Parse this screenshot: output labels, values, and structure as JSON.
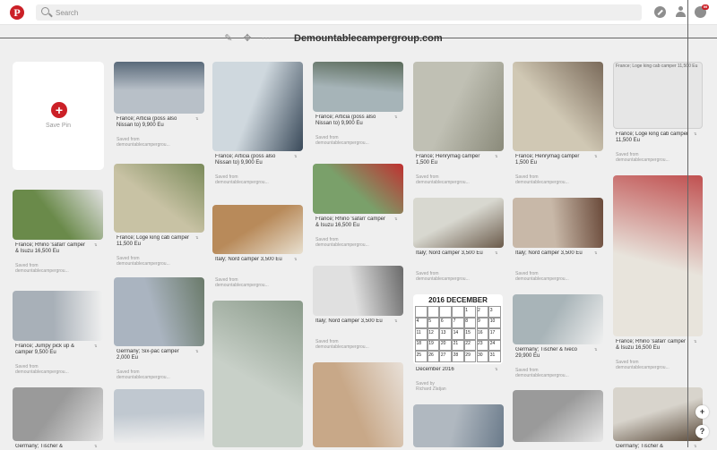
{
  "search": {
    "placeholder": "Search"
  },
  "header": {
    "notification_count": "99"
  },
  "pin_page": {
    "site": "Demountablecampergroup.com",
    "save_pin_label": "Save Pin"
  },
  "pins": [
    {
      "title": "France; Articia (poss also Nissan to) 9,900 Eu",
      "saved": "Saved from",
      "source": "demountablecampergrou..."
    },
    {
      "title": "France; Loge king cab camper 11,500 Eu",
      "saved": "Saved from",
      "source": "demountablecampergrou..."
    },
    {
      "title": "Germany; Six-pac camper 2,000 Eu",
      "saved": "Saved from",
      "source": "demountablecampergrou..."
    },
    {
      "title": "France; Articia (poss also Nissan to) 9,900 Eu",
      "saved": "Saved from",
      "source": "demountablecampergrou..."
    },
    {
      "title": "Italy; Nord camper 3,500 Eu",
      "saved": "Saved from",
      "source": "demountablecampergrou..."
    },
    {
      "title": "France; Articia (poss also Nissan to) 9,900 Eu",
      "saved": "Saved from",
      "source": "demountablecampergrou..."
    },
    {
      "title": "France; Rhino 'safari' camper & Isuzu 16,500 Eu",
      "saved": "Saved from",
      "source": "demountablecampergrou..."
    },
    {
      "title": "Italy; Nord camper 3,500 Eu",
      "saved": "Saved from",
      "source": "demountablecampergrou..."
    },
    {
      "title": "France; Henrymag camper 1,500 Eu",
      "saved": "Saved from",
      "source": "demountablecampergrou..."
    },
    {
      "title": "Italy; Nord camper 3,500 Eu",
      "saved": "Saved from",
      "source": "demountablecampergrou..."
    },
    {
      "title": "December 2016",
      "saved": "Saved by",
      "source": "Richard Zlatjan"
    },
    {
      "title": "France; Henrymag camper 1,500 Eu",
      "saved": "Saved from",
      "source": "demountablecampergrou..."
    },
    {
      "title": "Italy; Nord camper 3,500 Eu",
      "saved": "Saved from",
      "source": "demountablecampergrou..."
    },
    {
      "title": "Germany; Tischer & Iveco 29,900 Eu",
      "saved": "Saved from",
      "source": "demountablecampergrou..."
    },
    {
      "title": "France; Loge king cab camper 11,500 Eu",
      "saved": "Saved from",
      "source": "demountablecampergrou..."
    },
    {
      "title": "France; Rhino 'safari' camper & Isuzu 16,500 Eu",
      "saved": "Saved from",
      "source": "demountablecampergrou..."
    },
    {
      "title": "France; Rhino 'safari' camper & Isuzu 16,500 Eu",
      "saved": "Saved from",
      "source": "demountablecampergrou..."
    },
    {
      "title": "France; Jumpy pick up & camper 9,500 Eu",
      "saved": "Saved from",
      "source": "demountablecampergrou..."
    },
    {
      "title": "Germany; Tischer &"
    },
    {
      "title": "Germany; Tischer &"
    }
  ],
  "broken_image_alt": "France; Loge king cab camper 11,500 Eu",
  "calendar": {
    "header": "2016  DECEMBER",
    "numbers": [
      "",
      "",
      "",
      "",
      "1",
      "2",
      "3",
      "4",
      "5",
      "6",
      "7",
      "8",
      "9",
      "10",
      "11",
      "12",
      "13",
      "14",
      "15",
      "16",
      "17",
      "18",
      "19",
      "20",
      "21",
      "22",
      "23",
      "24",
      "25",
      "26",
      "27",
      "28",
      "29",
      "30",
      "31"
    ]
  },
  "colors": {
    "brand": "#cb2027",
    "background": "#efefef",
    "card": "#ffffff"
  },
  "side_buttons": {
    "add": "+",
    "help": "?"
  },
  "icons": {
    "logo": "pinterest-logo-icon",
    "search": "search-icon",
    "explore": "compass-icon",
    "profile": "profile-icon",
    "messages": "messages-icon",
    "edit": "pencil-icon",
    "move": "move-arrows-icon",
    "more": "more-dots-icon"
  }
}
